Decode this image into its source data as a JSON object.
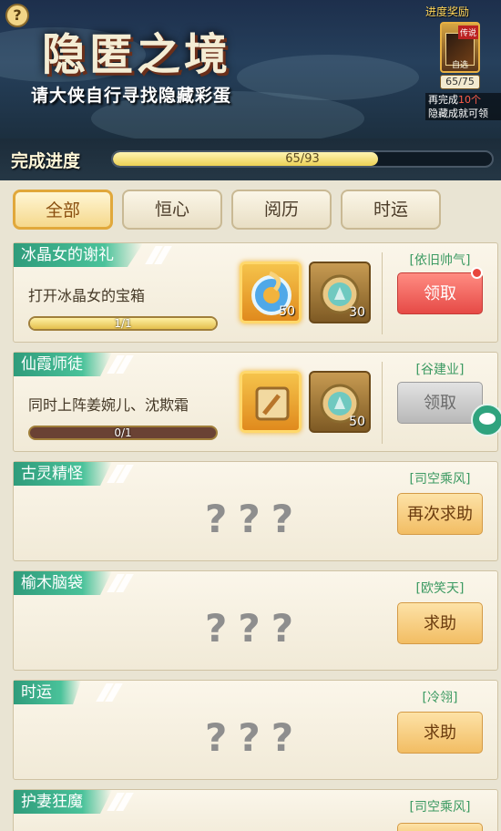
{
  "header": {
    "help_icon": "?",
    "title": "隐匿之境",
    "subtitle": "请大侠自行寻找隐藏彩蛋"
  },
  "reward": {
    "title": "进度奖励",
    "item_tag": "传说",
    "item_name": "自选",
    "count": "65/75",
    "note_prefix": "再完成",
    "note_highlight": "10个",
    "note_line2": "隐藏成就可领"
  },
  "progress": {
    "label": "完成进度",
    "text": "65/93",
    "fraction": 0.699
  },
  "tabs": [
    "全部",
    "恒心",
    "阅历",
    "时运"
  ],
  "cards": [
    {
      "title": "冰晶女的谢礼",
      "desc": "打开冰晶女的宝箱",
      "progress": "1/1",
      "hero": "[依旧帅气]",
      "button": "领取",
      "items": [
        "50",
        "30"
      ]
    },
    {
      "title": "仙霞师徒",
      "desc": "同时上阵姜婉儿、沈欺霜",
      "progress": "0/1",
      "hero": "[谷建业]",
      "button": "领取",
      "items": [
        "",
        "50"
      ]
    },
    {
      "title": "古灵精怪",
      "qmarks": "???",
      "hero": "[司空乘风]",
      "button": "再次求助"
    },
    {
      "title": "榆木脑袋",
      "qmarks": "???",
      "hero": "[欧笑天]",
      "button": "求助"
    },
    {
      "title": "时运",
      "qmarks": "???",
      "hero": "[冷翎]",
      "button": "求助"
    },
    {
      "title": "护妻狂魔",
      "hero": "[司空乘风]"
    }
  ]
}
